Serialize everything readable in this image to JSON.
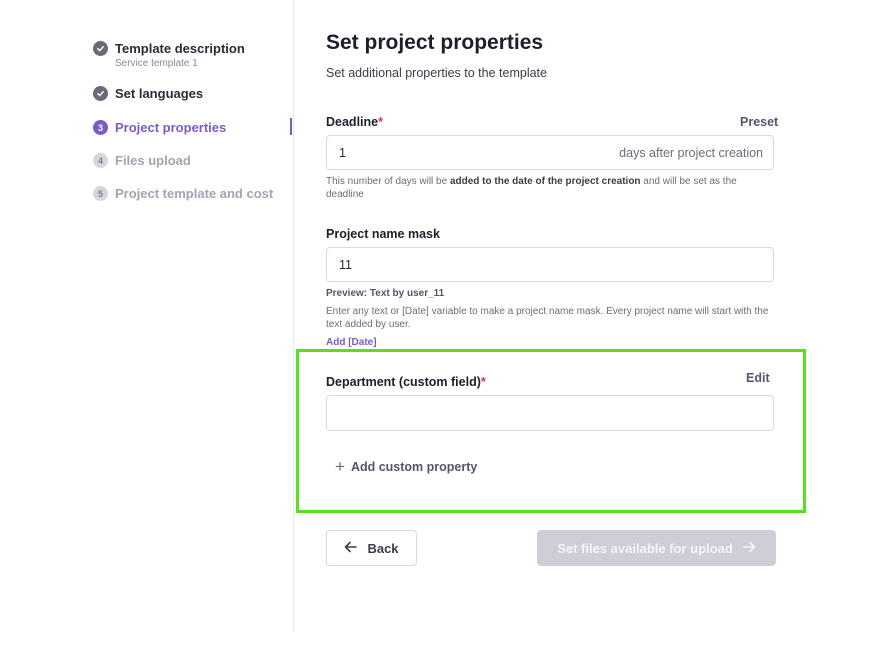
{
  "sidebar": {
    "steps": [
      {
        "number": "✓",
        "label": "Template description",
        "sub": "Service template 1",
        "state": "done"
      },
      {
        "number": "✓",
        "label": "Set languages",
        "sub": "",
        "state": "done"
      },
      {
        "number": "3",
        "label": "Project properties",
        "sub": "",
        "state": "active"
      },
      {
        "number": "4",
        "label": "Files upload",
        "sub": "",
        "state": "todo"
      },
      {
        "number": "5",
        "label": "Project template and cost",
        "sub": "",
        "state": "todo"
      }
    ]
  },
  "main": {
    "title": "Set project properties",
    "subtitle": "Set additional properties to the template",
    "deadline": {
      "label": "Deadline",
      "required_mark": "*",
      "preset_link": "Preset",
      "value": "1",
      "suffix": "days after project creation",
      "help_prefix": "This number of days will be ",
      "help_bold": "added to the date of the project creation",
      "help_suffix": " and will be set as the deadline"
    },
    "name_mask": {
      "label": "Project name mask",
      "value": "11",
      "preview": "Preview: Text by user_11",
      "help": "Enter any text or [Date] variable to make a project name mask. Every project name will start with the text added by user.",
      "add_date": "Add [Date]"
    },
    "custom_field": {
      "label": "Department (custom field)",
      "required_mark": "*",
      "edit_link": "Edit",
      "value": ""
    },
    "add_custom_property": "Add custom property",
    "back_button": "Back",
    "next_button": "Set files available for upload"
  },
  "colors": {
    "accent": "#7c5cc4",
    "highlight": "#58e01c",
    "required": "#e0334c",
    "disabled_button": "#cfced8"
  }
}
